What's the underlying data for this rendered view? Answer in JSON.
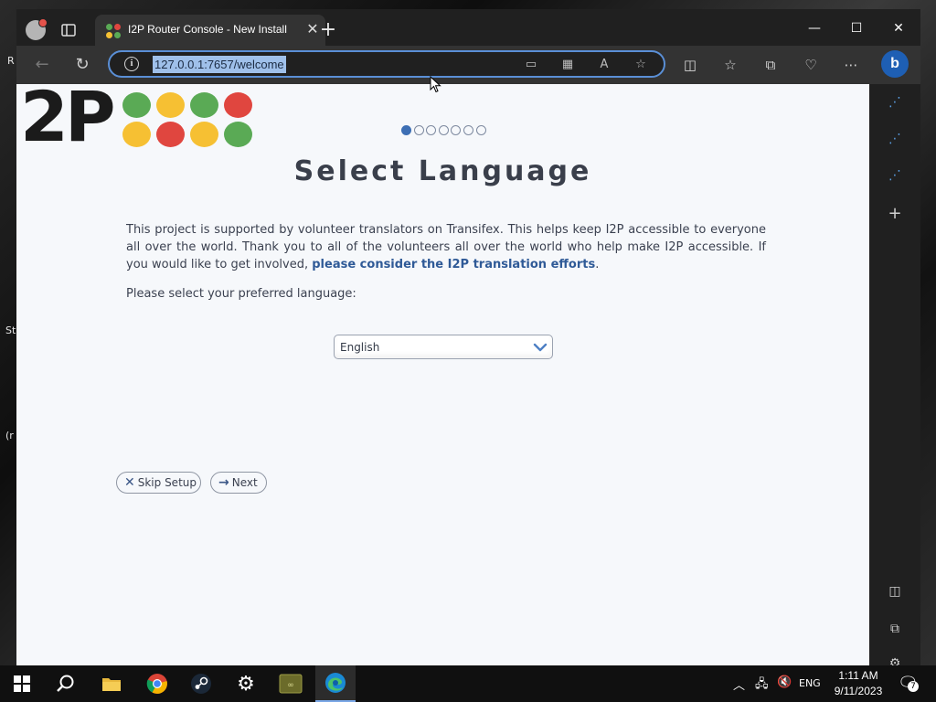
{
  "browser": {
    "tab_title": "I2P Router Console - New Install",
    "url": "127.0.0.1:7657/welcome"
  },
  "page": {
    "logo_text": "2P",
    "wizard_steps_total": 7,
    "wizard_step_current": 1,
    "title": "Select Language",
    "intro_text": "This project is supported by volunteer translators on Transifex. This helps keep I2P accessible to everyone all over the world. Thank you to all of the volunteers all over the world who help make I2P accessible. If you would like to get involved,",
    "intro_link": "please consider the I2P translation efforts",
    "intro_end": ".",
    "prompt": "Please select your preferred language:",
    "language_selected": "English",
    "skip_label": "Skip Setup",
    "next_label": "Next"
  },
  "taskbar": {
    "language": "ENG",
    "time": "1:11 AM",
    "date": "9/11/2023",
    "notification_count": "7"
  },
  "colors": {
    "accent": "#3d6fb4",
    "logo_green": "#5aaa55",
    "logo_yellow": "#f6c033",
    "logo_red": "#e0463f",
    "link": "#2f5a97"
  }
}
